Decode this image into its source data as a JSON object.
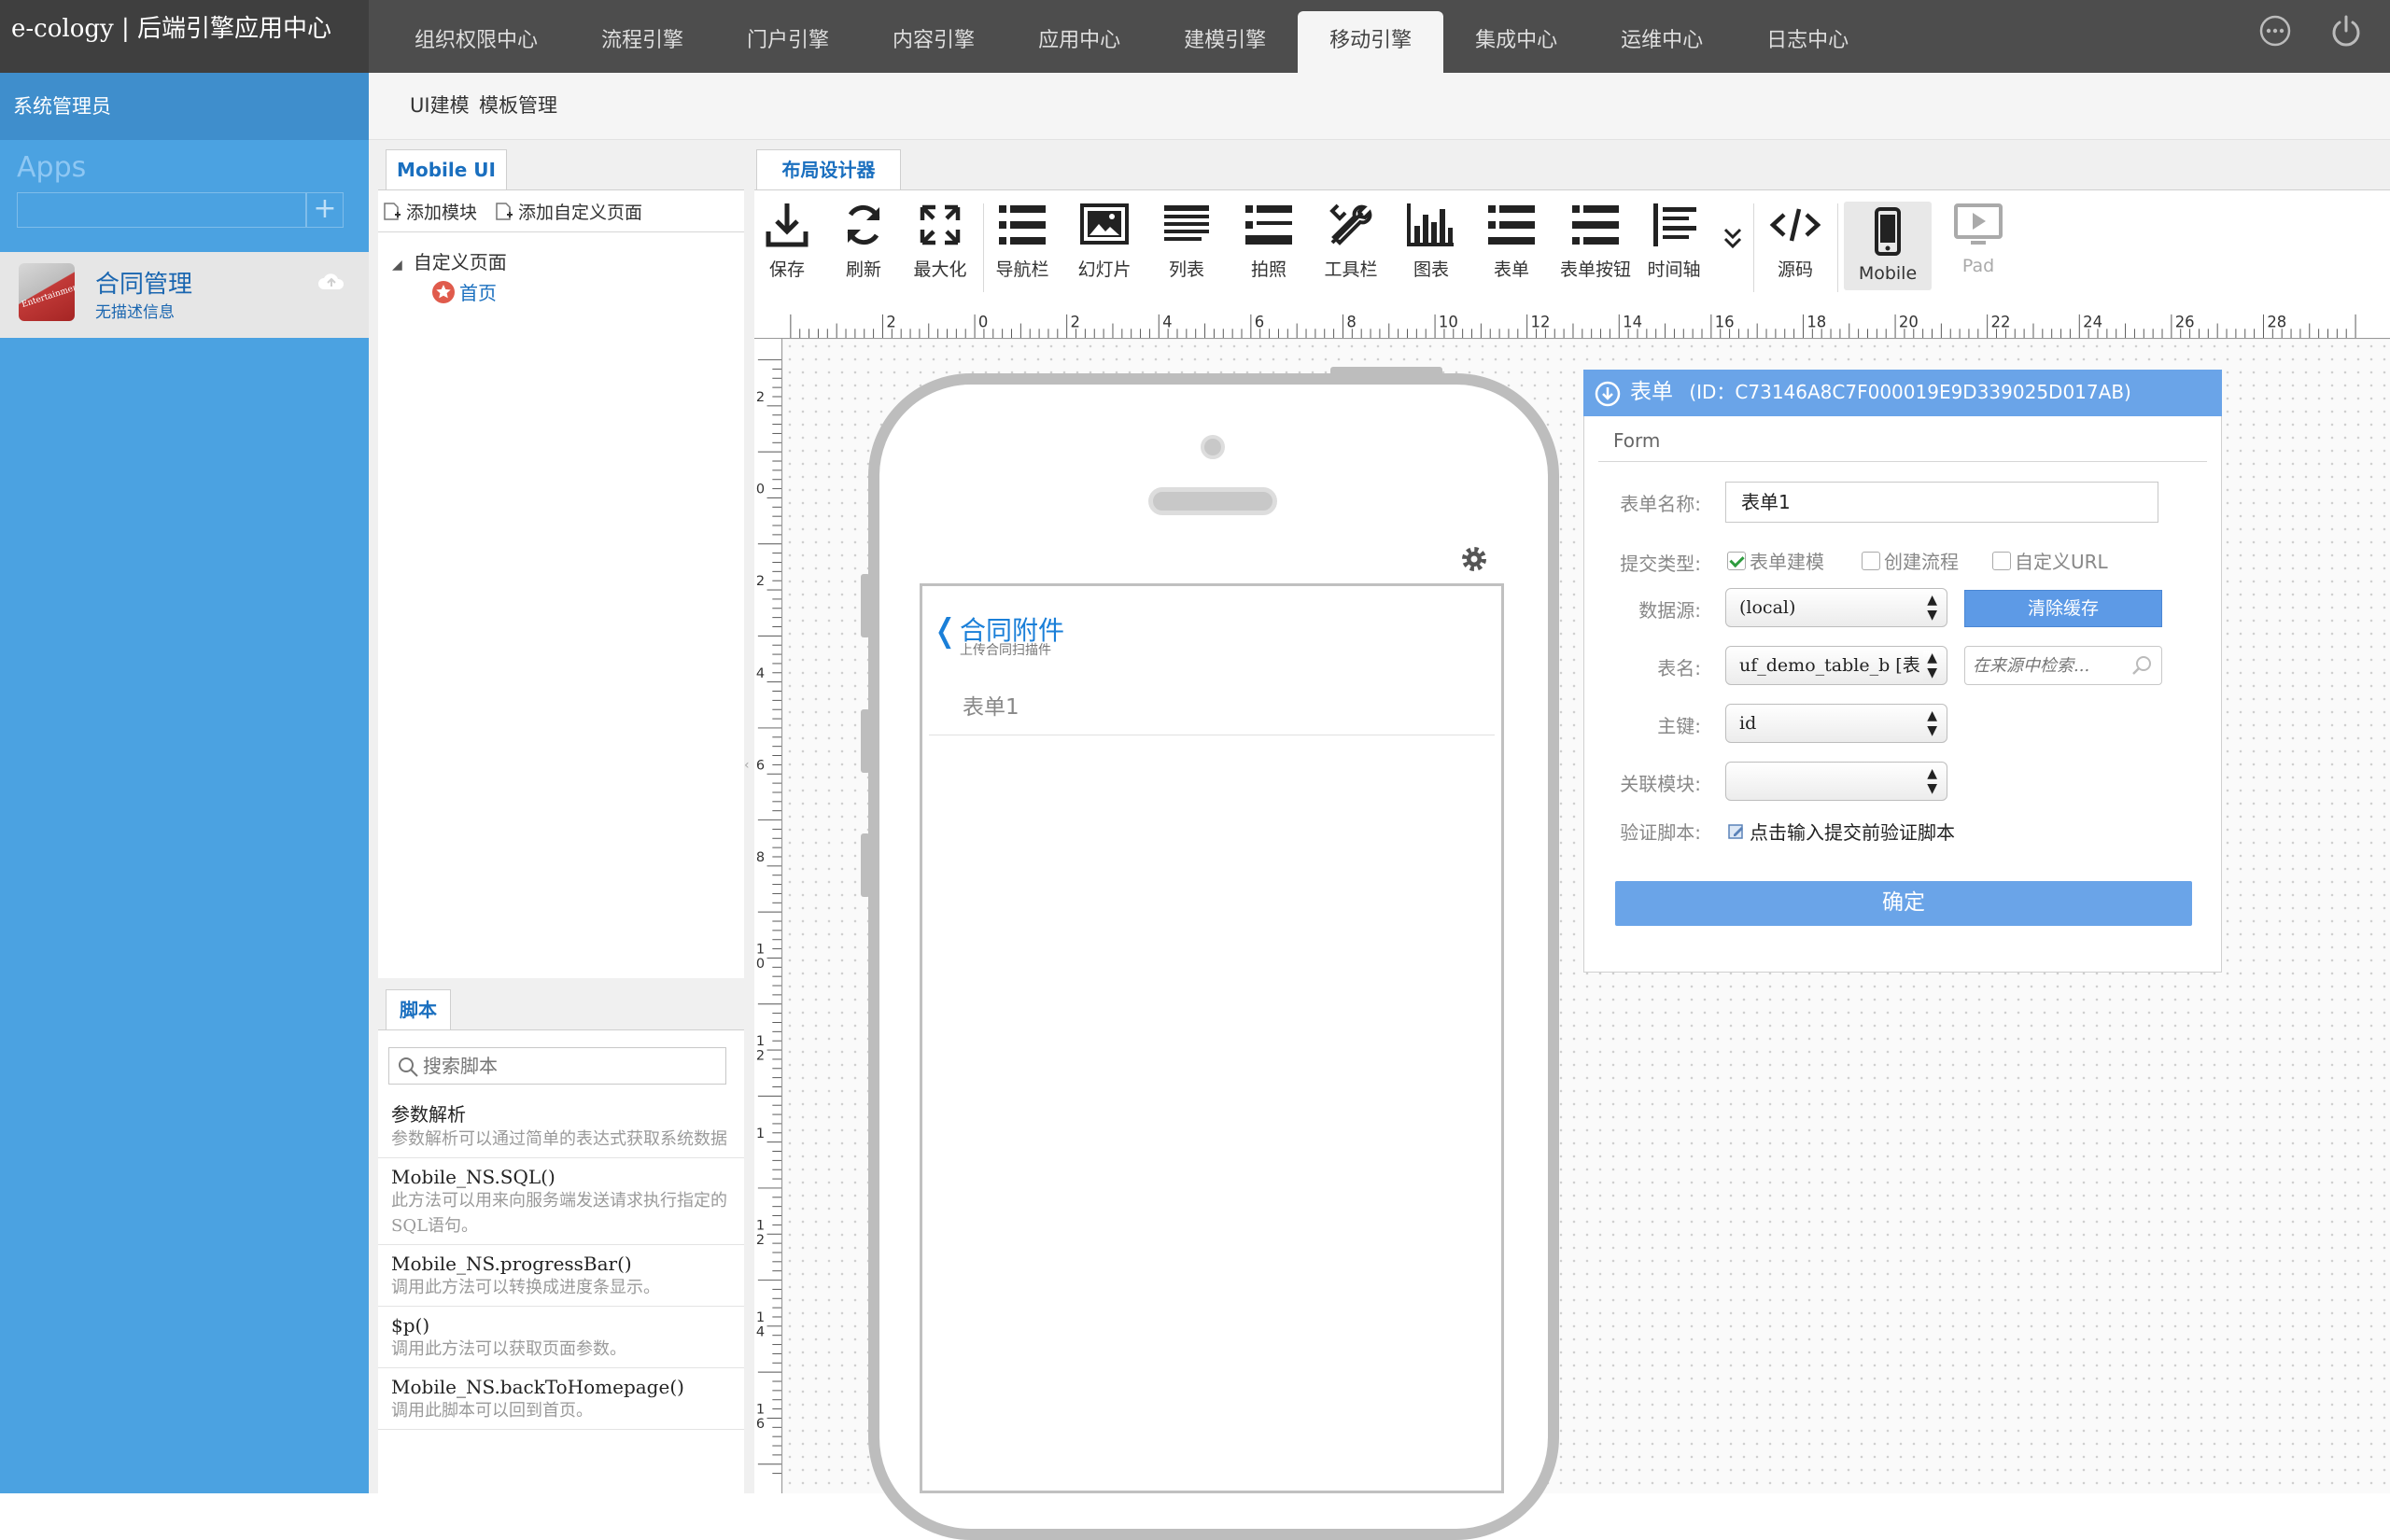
{
  "app": {
    "title": "e-cology | 后端引擎应用中心"
  },
  "nav": {
    "tabs": [
      "组织权限中心",
      "流程引擎",
      "门户引擎",
      "内容引擎",
      "应用中心",
      "建模引擎",
      "移动引擎",
      "集成中心",
      "运维中心",
      "日志中心"
    ],
    "active_tab": "移动引擎"
  },
  "topicons": {
    "more": "more-icon",
    "power": "power-icon"
  },
  "sidebar": {
    "user": "系统管理员",
    "apps_title": "Apps",
    "add_symbol": "+",
    "app": {
      "name": "合同管理",
      "desc": "无描述信息",
      "logo_text": "Entertainment"
    }
  },
  "subnav": {
    "items": [
      "UI建模",
      "模板管理"
    ]
  },
  "left_panel": {
    "tab": "Mobile UI",
    "add_module": "添加模块",
    "add_custom_page": "添加自定义页面",
    "tree_root": "自定义页面",
    "tree_child": "首页"
  },
  "script_panel": {
    "tab": "脚本",
    "search_placeholder": "搜索脚本",
    "items": [
      {
        "title": "参数解析",
        "desc": "参数解析可以通过简单的表达式获取系统数据"
      },
      {
        "title": "Mobile_NS.SQL()",
        "desc": "此方法可以用来向服务端发送请求执行指定的SQL语句。"
      },
      {
        "title": "Mobile_NS.progressBar()",
        "desc": "调用此方法可以转换成进度条显示。"
      },
      {
        "title": "$p()",
        "desc": "调用此方法可以获取页面参数。"
      },
      {
        "title": "Mobile_NS.backToHomepage()",
        "desc": "调用此脚本可以回到首页。"
      }
    ]
  },
  "designer": {
    "tab": "布局设计器",
    "tools": [
      {
        "label": "保存",
        "icon": "download-icon"
      },
      {
        "label": "刷新",
        "icon": "refresh-icon"
      },
      {
        "label": "最大化",
        "icon": "maximize-icon"
      },
      {
        "label": "导航栏",
        "icon": "navbar-icon"
      },
      {
        "label": "幻灯片",
        "icon": "slideshow-icon"
      },
      {
        "label": "列表",
        "icon": "list-icon"
      },
      {
        "label": "拍照",
        "icon": "photo-icon"
      },
      {
        "label": "工具栏",
        "icon": "tools-icon"
      },
      {
        "label": "图表",
        "icon": "chart-icon"
      },
      {
        "label": "表单",
        "icon": "form-icon"
      },
      {
        "label": "表单按钮",
        "icon": "form-button-icon"
      },
      {
        "label": "时间轴",
        "icon": "timeline-icon"
      },
      {
        "label": "",
        "icon": "expand-more-icon"
      },
      {
        "label": "源码",
        "icon": "source-code-icon"
      },
      {
        "label": "Mobile",
        "icon": "mobile-icon"
      },
      {
        "label": "Pad",
        "icon": "pad-icon"
      }
    ],
    "ruler_h": [
      "2",
      "0",
      "2",
      "4",
      "6",
      "8",
      "10",
      "12",
      "14",
      "16",
      "18",
      "20",
      "22",
      "24",
      "26",
      "28"
    ],
    "ruler_v": [
      "2",
      "0",
      "2",
      "4",
      "6",
      "8",
      "1\n0",
      "1\n2",
      "1",
      "1\n2",
      "1\n4",
      "1\n6"
    ]
  },
  "phone": {
    "back": "❬",
    "title": "合同附件",
    "subtitle": "上传合同扫描件",
    "form_label": "表单1"
  },
  "properties": {
    "header_title": "表单",
    "header_id": "(ID：C73146A8C7F000019E9D339025D017AB)",
    "section": "Form",
    "name_label": "表单名称:",
    "name_value": "表单1",
    "submit_label": "提交类型:",
    "submit_options": [
      {
        "label": "表单建模",
        "checked": true
      },
      {
        "label": "创建流程",
        "checked": false
      },
      {
        "label": "自定义URL",
        "checked": false
      }
    ],
    "datasource_label": "数据源:",
    "datasource_value": "(local)",
    "clear_cache": "清除缓存",
    "table_label": "表名:",
    "table_value": "uf_demo_table_b [表",
    "table_search_placeholder": "在来源中检索...",
    "key_label": "主键:",
    "key_value": "id",
    "related_label": "关联模块:",
    "related_value": "",
    "verify_label": "验证脚本:",
    "verify_text": "点击输入提交前验证脚本",
    "confirm": "确定",
    "accent": "#6aa4e8"
  }
}
